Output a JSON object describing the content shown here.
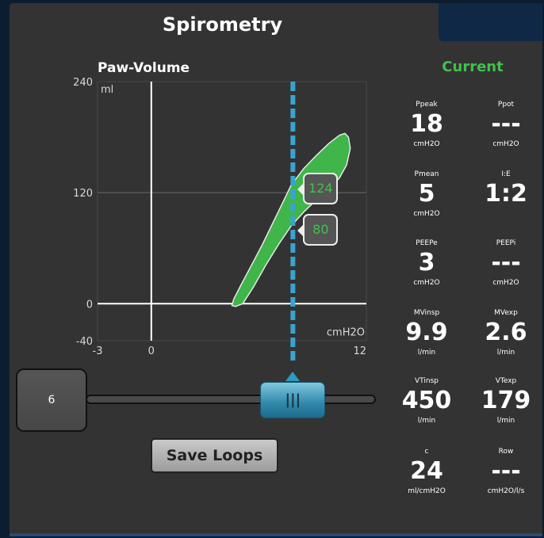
{
  "panel": {
    "title": "Spirometry"
  },
  "chart_data": {
    "type": "line",
    "title": "Paw-Volume",
    "x_unit": "cmH2O",
    "y_unit": "ml",
    "xlim": [
      -3,
      12
    ],
    "ylim": [
      -40,
      240
    ],
    "x_ticks": [
      "-3",
      "0",
      "12"
    ],
    "y_ticks": [
      "240",
      "120",
      "0",
      "-40"
    ],
    "grid": true,
    "series": [
      {
        "loop": [
          [
            4.5,
            -2
          ],
          [
            4.6,
            5
          ],
          [
            5.0,
            20
          ],
          [
            5.6,
            42
          ],
          [
            6.2,
            64
          ],
          [
            6.8,
            88
          ],
          [
            7.3,
            108
          ],
          [
            7.8,
            128
          ],
          [
            8.5,
            146
          ],
          [
            9.2,
            160
          ],
          [
            9.9,
            173
          ],
          [
            10.5,
            182
          ],
          [
            10.8,
            184
          ],
          [
            11.0,
            180
          ],
          [
            11.1,
            168
          ],
          [
            10.9,
            150
          ],
          [
            10.5,
            136
          ],
          [
            9.9,
            124
          ],
          [
            9.2,
            112
          ],
          [
            8.5,
            99
          ],
          [
            7.8,
            84
          ],
          [
            7.1,
            64
          ],
          [
            6.4,
            42
          ],
          [
            5.7,
            18
          ],
          [
            5.1,
            0
          ],
          [
            4.7,
            -3
          ]
        ]
      }
    ],
    "cursor": {
      "x": 7.9,
      "values": [
        "124",
        "80"
      ]
    }
  },
  "cursor_control": {
    "value": "6"
  },
  "save_button": {
    "label": "Save Loops"
  },
  "current": {
    "label": "Current",
    "params": [
      {
        "name": "Ppeak",
        "value": "18",
        "unit": "cmH2O"
      },
      {
        "name": "Ppot",
        "value": "---",
        "unit": "cmH2O"
      },
      {
        "name": "Pmean",
        "value": "5",
        "unit": "cmH2O"
      },
      {
        "name": "I:E",
        "value": "1:2",
        "unit": ""
      },
      {
        "name": "PEEPe",
        "value": "3",
        "unit": "cmH2O"
      },
      {
        "name": "PEEPi",
        "value": "---",
        "unit": "cmH2O"
      },
      {
        "name": "MVinsp",
        "value": "9.9",
        "unit": "l/min"
      },
      {
        "name": "MVexp",
        "value": "2.6",
        "unit": "l/min"
      },
      {
        "name": "VTinsp",
        "value": "450",
        "unit": "l/min"
      },
      {
        "name": "VTexp",
        "value": "179",
        "unit": "l/min"
      },
      {
        "name": "c",
        "value": "24",
        "unit": "ml/cmH2O"
      },
      {
        "name": "Row",
        "value": "---",
        "unit": "cmH2O/l/s"
      }
    ]
  },
  "colors": {
    "loop_fill": "#3fb54a",
    "cursor_line": "#3aa3cf",
    "current_label": "#3fc24b"
  }
}
